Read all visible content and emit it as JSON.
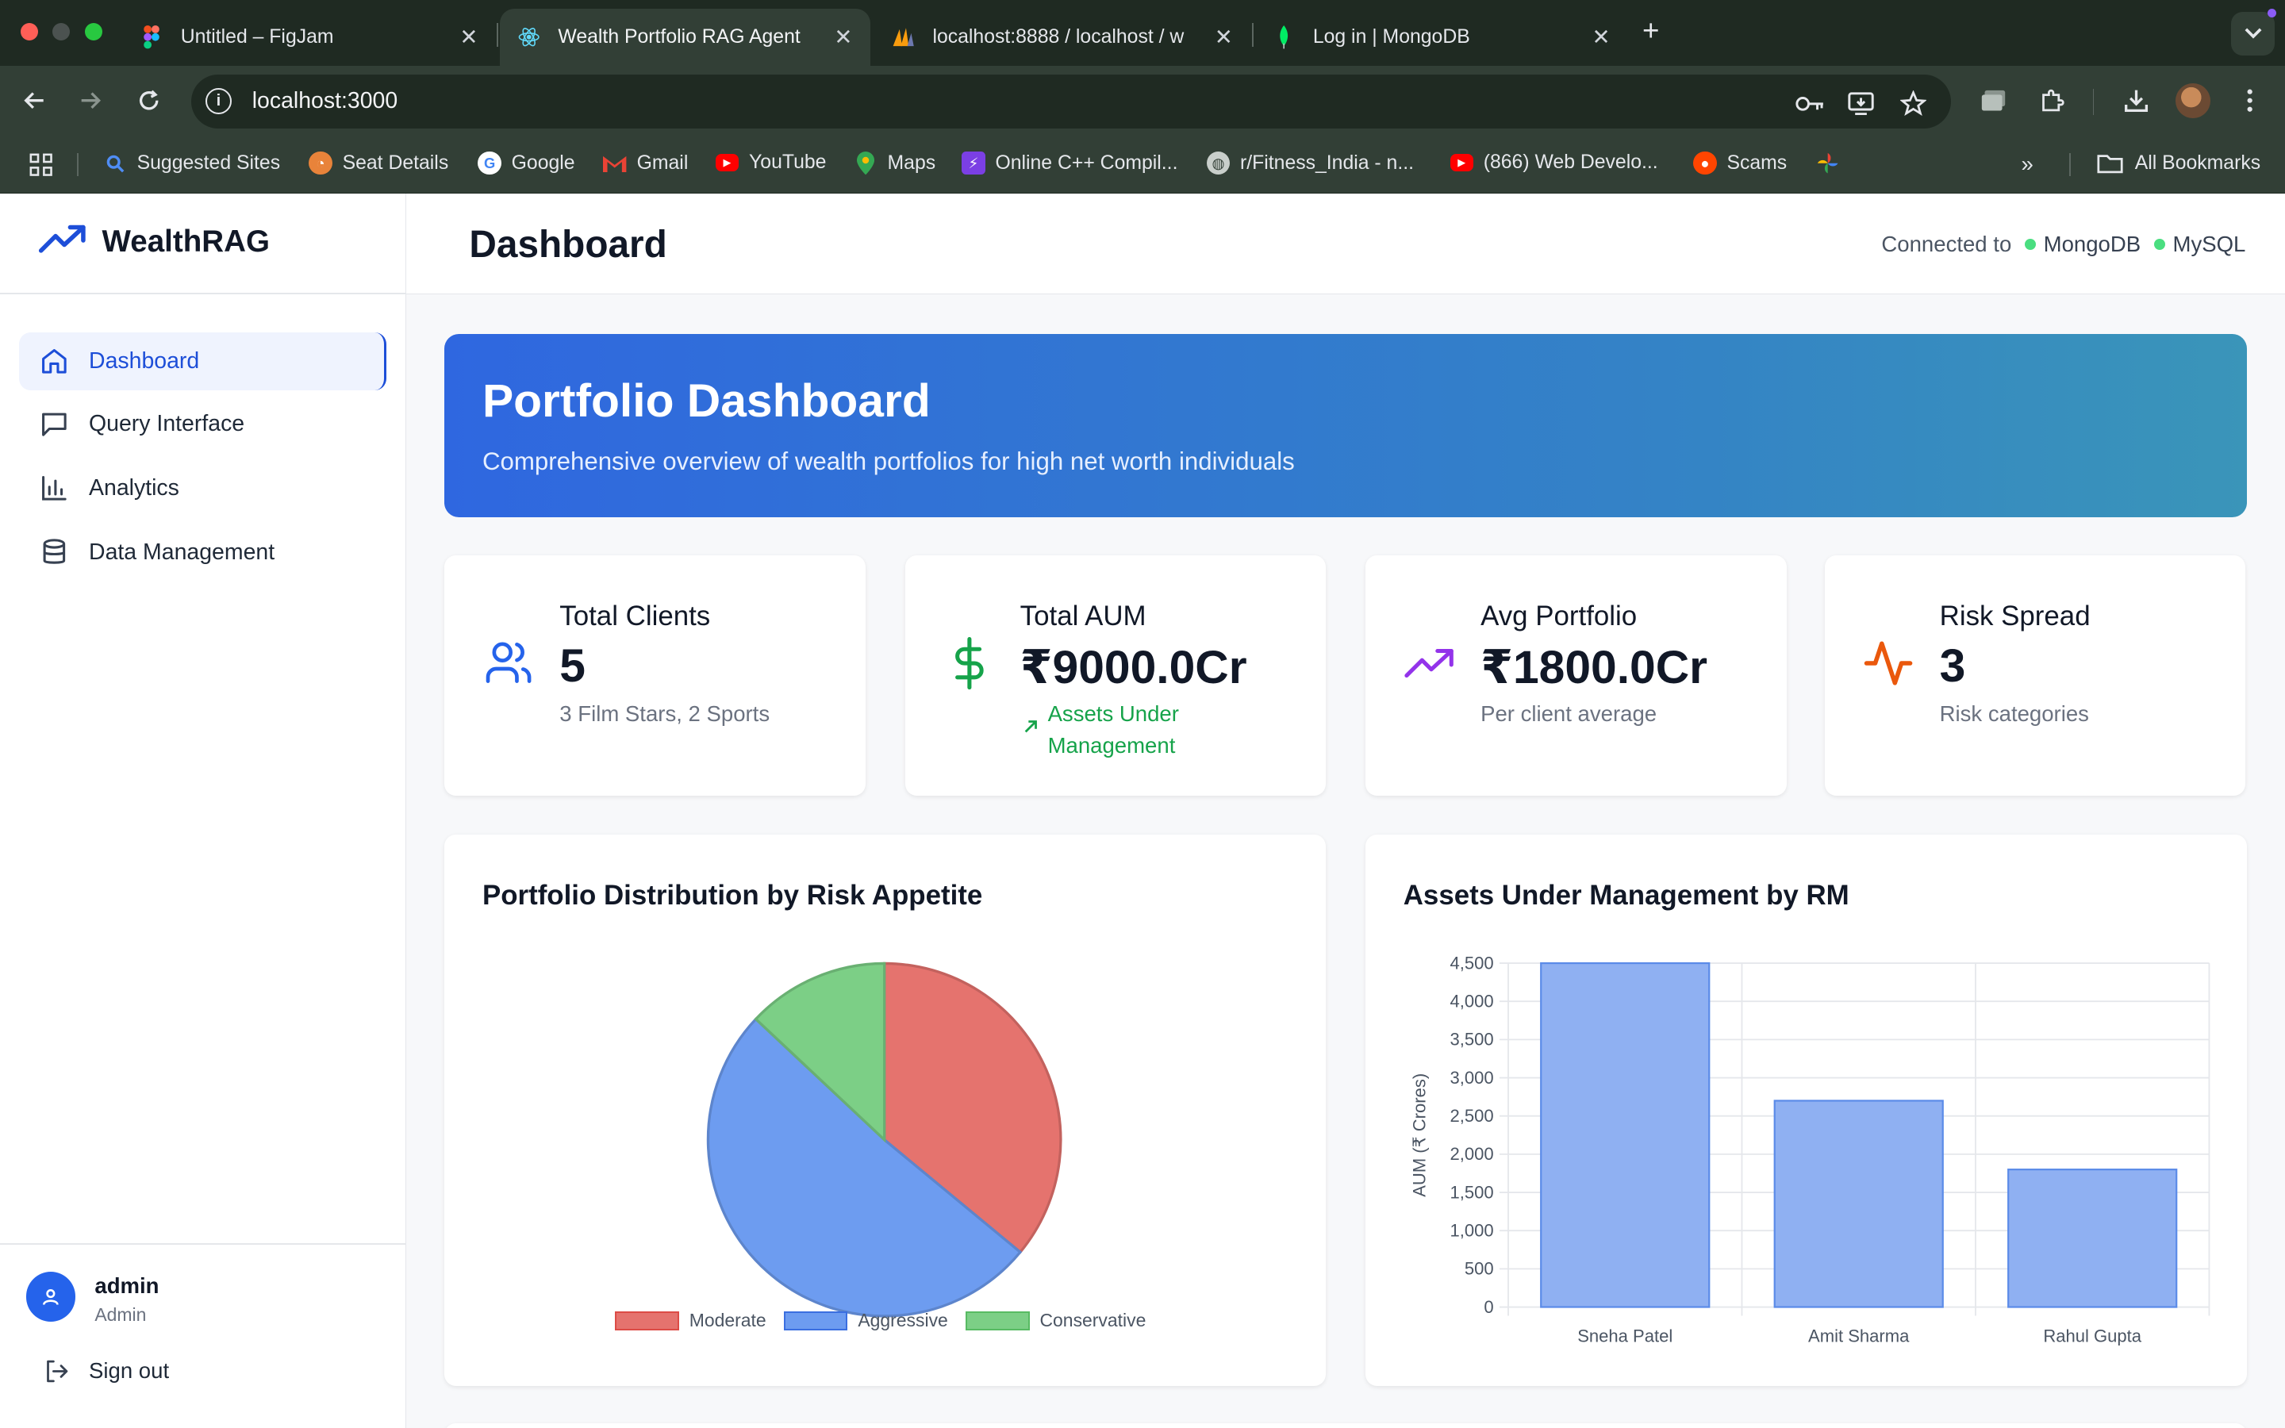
{
  "browser": {
    "tabs": [
      {
        "title": "Untitled – FigJam",
        "active": false
      },
      {
        "title": "Wealth Portfolio RAG Agent",
        "active": true
      },
      {
        "title": "localhost:8888 / localhost / w",
        "active": false
      },
      {
        "title": "Log in | MongoDB",
        "active": false
      }
    ],
    "url": "localhost:3000",
    "bookmarks": [
      "Suggested Sites",
      "Seat Details",
      "Google",
      "Gmail",
      "YouTube",
      "Maps",
      "Online C++ Compil...",
      "r/Fitness_India - n...",
      "(866) Web Develo...",
      "Scams"
    ],
    "all_bookmarks": "All Bookmarks"
  },
  "sidebar": {
    "brand": "WealthRAG",
    "items": [
      {
        "label": "Dashboard",
        "icon": "home-icon",
        "active": true
      },
      {
        "label": "Query Interface",
        "icon": "chat-icon",
        "active": false
      },
      {
        "label": "Analytics",
        "icon": "bar-chart-icon",
        "active": false
      },
      {
        "label": "Data Management",
        "icon": "database-icon",
        "active": false
      }
    ],
    "user": {
      "name": "admin",
      "role": "Admin"
    },
    "signout": "Sign out"
  },
  "header": {
    "title": "Dashboard",
    "connected_label": "Connected to",
    "databases": [
      "MongoDB",
      "MySQL"
    ],
    "status_color": "#4ade80"
  },
  "hero": {
    "title": "Portfolio Dashboard",
    "subtitle": "Comprehensive overview of wealth portfolios for high net worth individuals"
  },
  "stats": [
    {
      "label": "Total Clients",
      "value": "5",
      "sub": "3 Film Stars, 2 Sports",
      "icon": "users-icon",
      "color": "#2563eb"
    },
    {
      "label": "Total AUM",
      "value": "₹9000.0Cr",
      "sub": "Assets Under Management",
      "icon": "dollar-icon",
      "color": "#16a34a"
    },
    {
      "label": "Avg Portfolio",
      "value": "₹1800.0Cr",
      "sub": "Per client average",
      "icon": "trending-up-icon",
      "color": "#9333ea"
    },
    {
      "label": "Risk Spread",
      "value": "3",
      "sub": "Risk categories",
      "icon": "activity-icon",
      "color": "#ea580c"
    }
  ],
  "chart_data": [
    {
      "type": "pie",
      "title": "Portfolio Distribution by Risk Appetite",
      "categories": [
        "Moderate",
        "Aggressive",
        "Conservative"
      ],
      "values": [
        36,
        51,
        13
      ],
      "colors": [
        "#e5736e",
        "#6d9cf0",
        "#7ccf86"
      ],
      "legend": "bottom"
    },
    {
      "type": "bar",
      "title": "Assets Under Management by RM",
      "categories": [
        "Sneha Patel",
        "Amit Sharma",
        "Rahul Gupta"
      ],
      "values": [
        4500,
        2700,
        1800
      ],
      "ylabel": "AUM (₹ Crores)",
      "ylim": [
        0,
        4500
      ],
      "yticks": [
        "0",
        "500",
        "1,000",
        "1,500",
        "2,000",
        "2,500",
        "3,000",
        "3,500",
        "4,000",
        "4,500"
      ],
      "grid": true,
      "color": "#8fb0f2"
    }
  ]
}
